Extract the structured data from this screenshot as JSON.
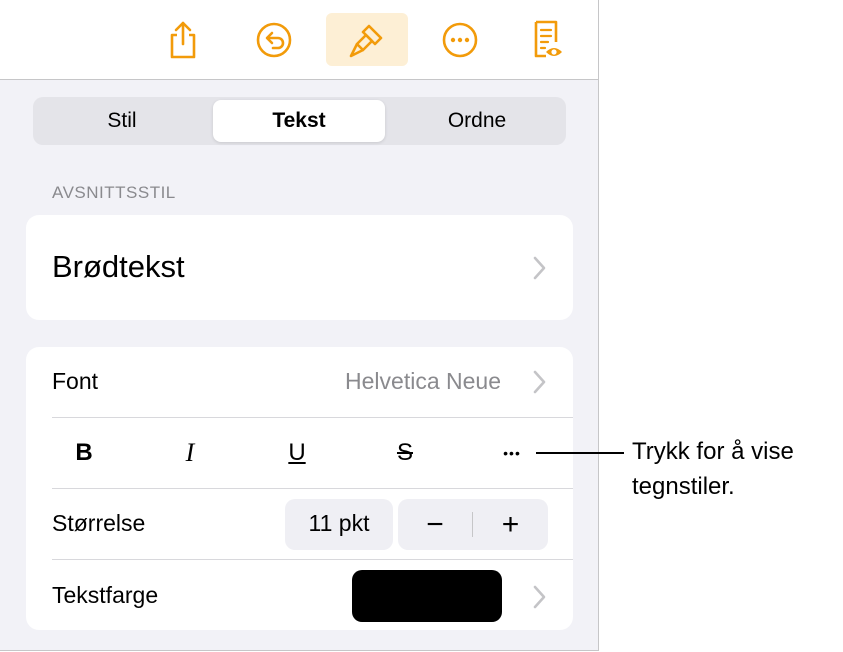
{
  "toolbar": {
    "items": [
      {
        "icon": "share-icon"
      },
      {
        "icon": "undo-icon"
      },
      {
        "icon": "paintbrush-icon",
        "active": true
      },
      {
        "icon": "more-icon"
      },
      {
        "icon": "reading-view-icon"
      }
    ],
    "accent_color": "#f29b0a"
  },
  "segmented": {
    "tabs": [
      "Stil",
      "Tekst",
      "Ordne"
    ],
    "selected": "Tekst"
  },
  "paragraph_style": {
    "section_label": "AVSNITTSSTIL",
    "value": "Brødtekst"
  },
  "font": {
    "label": "Font",
    "value": "Helvetica Neue"
  },
  "format_buttons": {
    "bold": "B",
    "italic": "I",
    "underline": "U",
    "strikethrough": "S",
    "more": "•••"
  },
  "size": {
    "label": "Størrelse",
    "value": "11 pkt",
    "minus": "−",
    "plus": "+"
  },
  "text_color": {
    "label": "Tekstfarge",
    "swatch_color": "#000000"
  },
  "callout": {
    "text": "Trykk for å vise tegnstiler."
  }
}
